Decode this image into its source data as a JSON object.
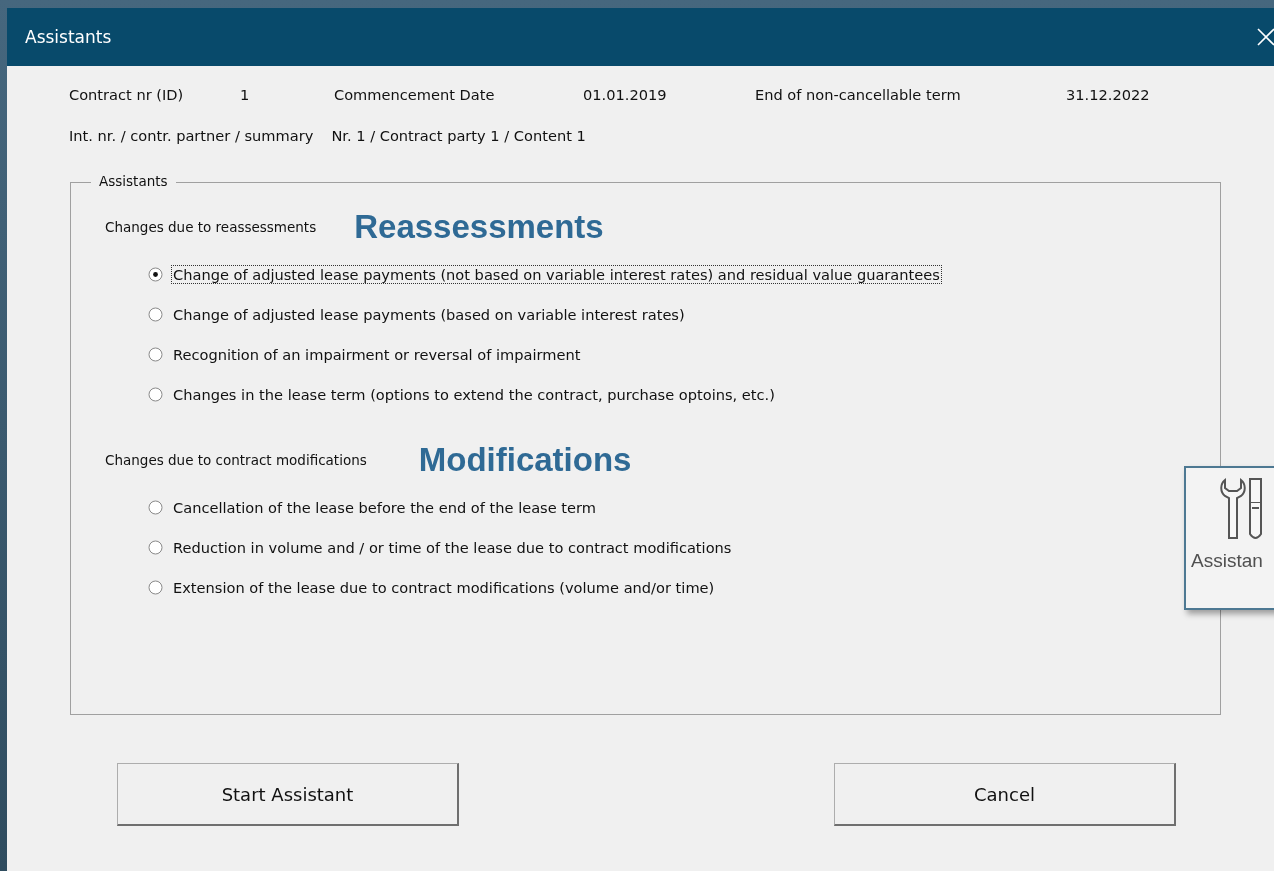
{
  "window": {
    "title": "Assistants"
  },
  "header": {
    "fields": [
      {
        "label": "Contract nr (ID)",
        "value": "1"
      },
      {
        "label": "Commencement Date",
        "value": "01.01.2019"
      },
      {
        "label": "End of non-cancellable term",
        "value": "31.12.2022"
      }
    ],
    "summary": {
      "label": "Int. nr. / contr. partner / summary",
      "value": "Nr. 1 / Contract party 1 / Content 1"
    }
  },
  "group": {
    "legend": "Assistants",
    "sections": [
      {
        "heading": "Changes due to reassessments",
        "annotation": "Reassessments",
        "options": [
          {
            "label": "Change of adjusted lease payments (not based on variable interest rates) and residual value guarantees",
            "selected": true
          },
          {
            "label": "Change of adjusted lease payments (based on variable interest rates)",
            "selected": false
          },
          {
            "label": "Recognition of an impairment or reversal of impairment",
            "selected": false
          },
          {
            "label": "Changes in the lease term (options to extend the contract, purchase optoins, etc.)",
            "selected": false
          }
        ]
      },
      {
        "heading": "Changes due to contract modifications",
        "annotation": "Modifications",
        "options": [
          {
            "label": "Cancellation of the lease before the end of the lease term",
            "selected": false
          },
          {
            "label": "Reduction in volume and / or time of the lease due to contract modifications",
            "selected": false
          },
          {
            "label": "Extension of the lease due to contract modifications (volume and/or time)",
            "selected": false
          }
        ]
      }
    ]
  },
  "buttons": [
    "Start Assistant",
    "Cancel"
  ],
  "tool_card": {
    "label": "Assistan"
  }
}
